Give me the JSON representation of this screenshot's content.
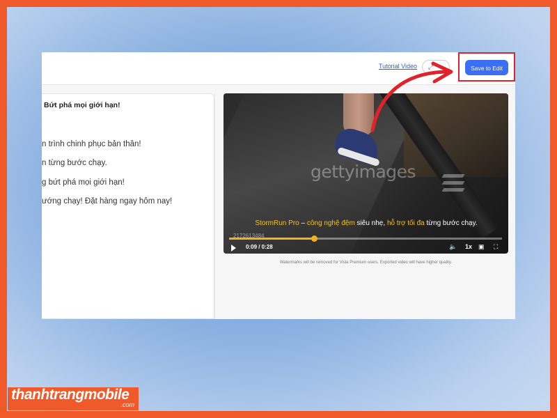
{
  "header": {
    "tutorial_label": "Tutorial Video",
    "share_icon": "share-icon",
    "save_label": "Save to Edit"
  },
  "script": {
    "title": "Bứt phá mọi giới hạn!",
    "lines": [
      "n trình chinh phục bản thân!",
      "n từng bước chạy.",
      "g bứt phá mọi giới hạn!",
      "ướng chạy! Đặt hàng ngay hôm nay!"
    ]
  },
  "video": {
    "watermark": "gettyimages",
    "image_id": "2172613484",
    "caption": {
      "part1": "StormRun Pro",
      "part2": " – ",
      "part3": "công nghệ đệm",
      "part4": " siêu nhẹ, ",
      "part5": "hỗ trợ tối đa",
      "part6": " từng bước chạy."
    },
    "time": "0:09 / 0:28",
    "progress": 0.31,
    "speed": "1x",
    "note": "Watermarks will be removed for Visla Premium users. Exported video will have higher quality."
  },
  "colors": {
    "accent": "#3b6ef2",
    "highlight_border": "#e0232a",
    "progress": "#f2b21b",
    "caption_highlight": "#f3c21a",
    "brand": "#f05a2a"
  },
  "brand": {
    "name": "thanhtrangmobile",
    "suffix": ".com"
  }
}
